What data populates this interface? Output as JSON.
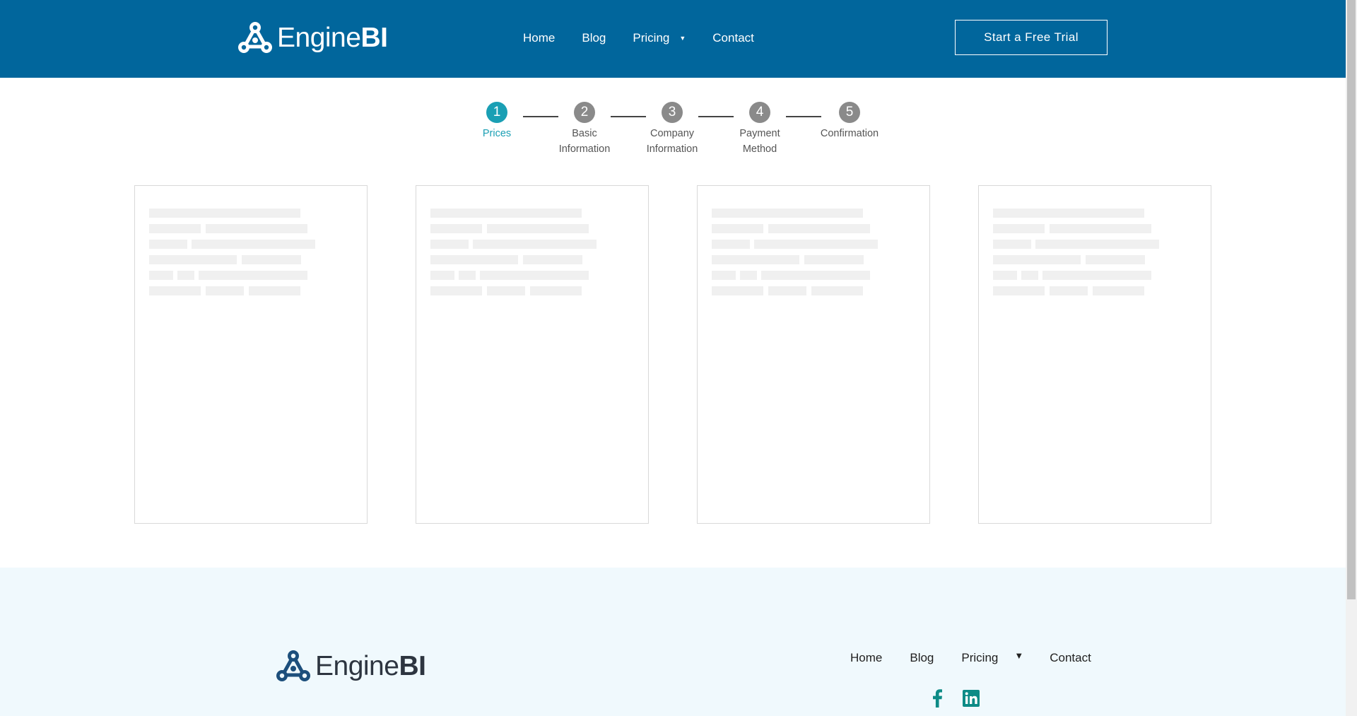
{
  "header": {
    "logo": {
      "light": "Engine",
      "bold": "BI"
    },
    "nav": [
      {
        "label": "Home"
      },
      {
        "label": "Blog"
      },
      {
        "label": "Pricing"
      },
      {
        "label": "Contact"
      }
    ],
    "cta": "Start a Free Trial",
    "bg_color": "#01669c"
  },
  "stepper": {
    "current_step": 1,
    "active_color": "#1a9fb4",
    "steps": [
      {
        "number": "1",
        "label_line1": "Prices",
        "label_line2": ""
      },
      {
        "number": "2",
        "label_line1": "Basic",
        "label_line2": "Information"
      },
      {
        "number": "3",
        "label_line1": "Company",
        "label_line2": "Information"
      },
      {
        "number": "4",
        "label_line1": "Payment",
        "label_line2": "Method"
      },
      {
        "number": "5",
        "label_line1": "Confirmation",
        "label_line2": ""
      }
    ]
  },
  "pricing_cards": {
    "count": 4,
    "state": "loading-placeholder"
  },
  "footer": {
    "logo": {
      "light": "Engine",
      "bold": "BI"
    },
    "nav": [
      {
        "label": "Home"
      },
      {
        "label": "Blog"
      },
      {
        "label": "Pricing"
      },
      {
        "label": "Contact"
      }
    ],
    "social": [
      {
        "icon": "facebook-icon"
      },
      {
        "icon": "linkedin-icon"
      }
    ],
    "social_color": "#0d8b86",
    "bg_color": "#f0f9fd"
  }
}
